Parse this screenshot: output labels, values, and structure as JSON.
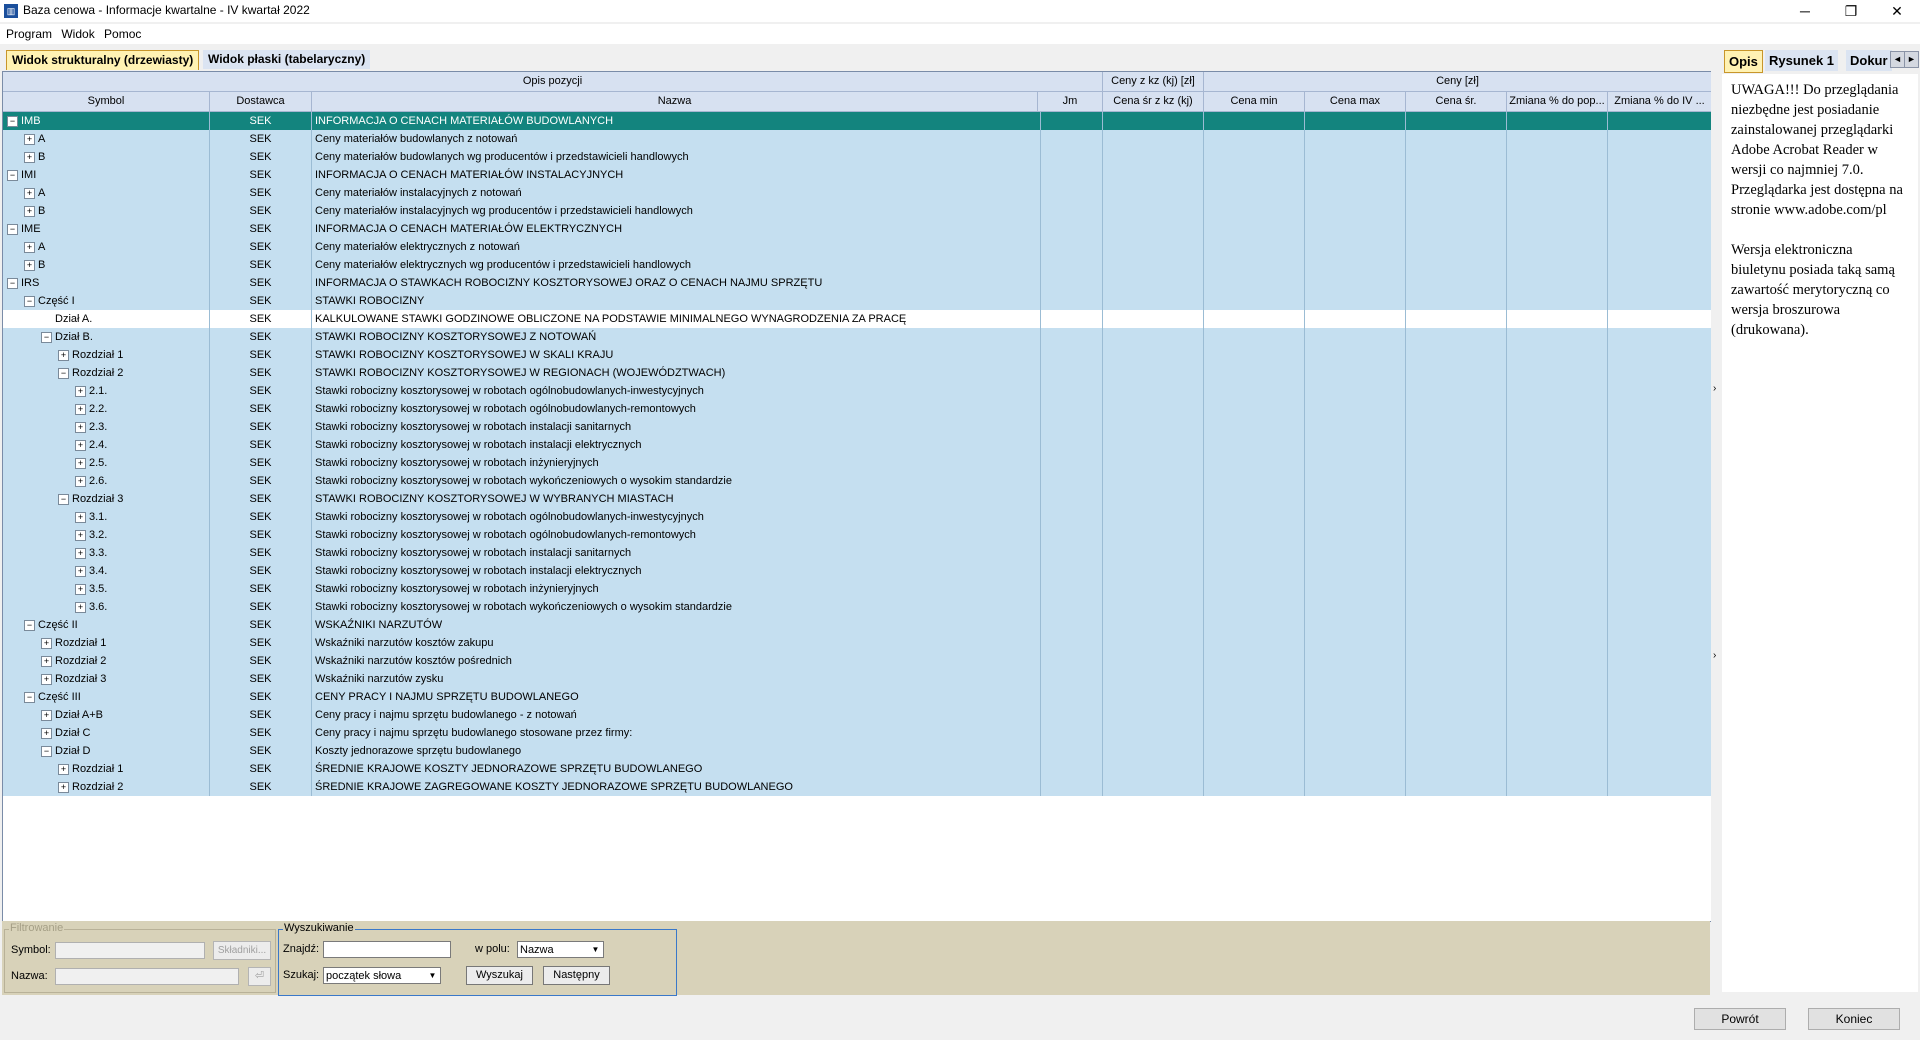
{
  "window": {
    "title": "Baza cenowa - Informacje kwartalne - IV kwartał 2022",
    "min_glyph": "─",
    "max_glyph": "❐",
    "close_glyph": "✕"
  },
  "menu": [
    "Program",
    "Widok",
    "Pomoc"
  ],
  "view_tabs": {
    "structural": "Widok strukturalny (drzewiasty)",
    "flat": "Widok płaski (tabelaryczny)"
  },
  "grid": {
    "group_headers": {
      "opis": "Opis pozycji",
      "kz": "Ceny z kz (kj) [zł]",
      "ceny": "Ceny [zł]"
    },
    "columns": {
      "symbol": "Symbol",
      "dostawca": "Dostawca",
      "nazwa": "Nazwa",
      "jm": "Jm",
      "cena_sr_kz": "Cena śr z kz (kj)",
      "cena_min": "Cena min",
      "cena_max": "Cena max",
      "cena_sr": "Cena śr.",
      "zmiana_pop": "Zmiana % do pop...",
      "zmiana_iv": "Zmiana % do IV ..."
    },
    "rows": [
      {
        "level": 0,
        "toggle": "−",
        "symbol": "IMB",
        "dostawca": "SEK",
        "nazwa": "INFORMACJA O CENACH MATERIAŁÓW BUDOWLANYCH",
        "style": "sel"
      },
      {
        "level": 1,
        "toggle": "+",
        "symbol": "A",
        "dostawca": "SEK",
        "nazwa": "Ceny materiałów budowlanych z notowań"
      },
      {
        "level": 1,
        "toggle": "+",
        "symbol": "B",
        "dostawca": "SEK",
        "nazwa": "Ceny materiałów budowlanych wg producentów i przedstawicieli handlowych"
      },
      {
        "level": 0,
        "toggle": "−",
        "symbol": "IMI",
        "dostawca": "SEK",
        "nazwa": "INFORMACJA O CENACH MATERIAŁÓW INSTALACYJNYCH"
      },
      {
        "level": 1,
        "toggle": "+",
        "symbol": "A",
        "dostawca": "SEK",
        "nazwa": "Ceny materiałów instalacyjnych z notowań"
      },
      {
        "level": 1,
        "toggle": "+",
        "symbol": "B",
        "dostawca": "SEK",
        "nazwa": "Ceny materiałów instalacyjnych wg producentów i przedstawicieli handlowych"
      },
      {
        "level": 0,
        "toggle": "−",
        "symbol": "IME",
        "dostawca": "SEK",
        "nazwa": "INFORMACJA O CENACH MATERIAŁÓW ELEKTRYCZNYCH"
      },
      {
        "level": 1,
        "toggle": "+",
        "symbol": "A",
        "dostawca": "SEK",
        "nazwa": "Ceny materiałów elektrycznych z notowań"
      },
      {
        "level": 1,
        "toggle": "+",
        "symbol": "B",
        "dostawca": "SEK",
        "nazwa": "Ceny materiałów elektrycznych wg producentów i przedstawicieli handlowych"
      },
      {
        "level": 0,
        "toggle": "−",
        "symbol": "IRS",
        "dostawca": "SEK",
        "nazwa": "INFORMACJA O STAWKACH ROBOCIZNY KOSZTORYSOWEJ ORAZ O CENACH NAJMU SPRZĘTU"
      },
      {
        "level": 1,
        "toggle": "−",
        "symbol": "Część I",
        "dostawca": "SEK",
        "nazwa": "STAWKI ROBOCIZNY"
      },
      {
        "level": 2,
        "toggle": "",
        "symbol": "Dział A.",
        "dostawca": "SEK",
        "nazwa": "KALKULOWANE STAWKI GODZINOWE OBLICZONE NA PODSTAWIE MINIMALNEGO WYNAGRODZENIA ZA PRACĘ",
        "style": "white"
      },
      {
        "level": 2,
        "toggle": "−",
        "symbol": "Dział B.",
        "dostawca": "SEK",
        "nazwa": "STAWKI ROBOCIZNY KOSZTORYSOWEJ Z NOTOWAŃ"
      },
      {
        "level": 3,
        "toggle": "+",
        "symbol": "Rozdział 1",
        "dostawca": "SEK",
        "nazwa": "STAWKI ROBOCIZNY KOSZTORYSOWEJ W SKALI KRAJU"
      },
      {
        "level": 3,
        "toggle": "−",
        "symbol": "Rozdział 2",
        "dostawca": "SEK",
        "nazwa": "STAWKI ROBOCIZNY KOSZTORYSOWEJ W REGIONACH (WOJEWÓDZTWACH)"
      },
      {
        "level": 4,
        "toggle": "+",
        "symbol": "2.1.",
        "dostawca": "SEK",
        "nazwa": "Stawki robocizny kosztorysowej w robotach ogólnobudowlanych-inwestycyjnych"
      },
      {
        "level": 4,
        "toggle": "+",
        "symbol": "2.2.",
        "dostawca": "SEK",
        "nazwa": "Stawki robocizny kosztorysowej w robotach ogólnobudowlanych-remontowych"
      },
      {
        "level": 4,
        "toggle": "+",
        "symbol": "2.3.",
        "dostawca": "SEK",
        "nazwa": "Stawki robocizny kosztorysowej w robotach instalacji sanitarnych"
      },
      {
        "level": 4,
        "toggle": "+",
        "symbol": "2.4.",
        "dostawca": "SEK",
        "nazwa": "Stawki robocizny kosztorysowej w robotach instalacji elektrycznych"
      },
      {
        "level": 4,
        "toggle": "+",
        "symbol": "2.5.",
        "dostawca": "SEK",
        "nazwa": "Stawki robocizny kosztorysowej w robotach inżynieryjnych"
      },
      {
        "level": 4,
        "toggle": "+",
        "symbol": "2.6.",
        "dostawca": "SEK",
        "nazwa": "Stawki robocizny kosztorysowej w robotach wykończeniowych o wysokim standardzie"
      },
      {
        "level": 3,
        "toggle": "−",
        "symbol": "Rozdział 3",
        "dostawca": "SEK",
        "nazwa": "STAWKI ROBOCIZNY KOSZTORYSOWEJ W WYBRANYCH MIASTACH"
      },
      {
        "level": 4,
        "toggle": "+",
        "symbol": "3.1.",
        "dostawca": "SEK",
        "nazwa": "Stawki robocizny kosztorysowej w robotach ogólnobudowlanych-inwestycyjnych"
      },
      {
        "level": 4,
        "toggle": "+",
        "symbol": "3.2.",
        "dostawca": "SEK",
        "nazwa": "Stawki robocizny kosztorysowej w robotach ogólnobudowlanych-remontowych"
      },
      {
        "level": 4,
        "toggle": "+",
        "symbol": "3.3.",
        "dostawca": "SEK",
        "nazwa": "Stawki robocizny kosztorysowej w robotach instalacji sanitarnych"
      },
      {
        "level": 4,
        "toggle": "+",
        "symbol": "3.4.",
        "dostawca": "SEK",
        "nazwa": "Stawki robocizny kosztorysowej w robotach instalacji elektrycznych"
      },
      {
        "level": 4,
        "toggle": "+",
        "symbol": "3.5.",
        "dostawca": "SEK",
        "nazwa": "Stawki robocizny kosztorysowej w robotach inżynieryjnych"
      },
      {
        "level": 4,
        "toggle": "+",
        "symbol": "3.6.",
        "dostawca": "SEK",
        "nazwa": "Stawki robocizny kosztorysowej w robotach wykończeniowych o wysokim standardzie"
      },
      {
        "level": 1,
        "toggle": "−",
        "symbol": "Część II",
        "dostawca": "SEK",
        "nazwa": "WSKAŹNIKI NARZUTÓW"
      },
      {
        "level": 2,
        "toggle": "+",
        "symbol": "Rozdział 1",
        "dostawca": "SEK",
        "nazwa": "Wskaźniki narzutów kosztów zakupu"
      },
      {
        "level": 2,
        "toggle": "+",
        "symbol": "Rozdział 2",
        "dostawca": "SEK",
        "nazwa": "Wskaźniki narzutów kosztów pośrednich"
      },
      {
        "level": 2,
        "toggle": "+",
        "symbol": "Rozdział 3",
        "dostawca": "SEK",
        "nazwa": "Wskaźniki narzutów zysku"
      },
      {
        "level": 1,
        "toggle": "−",
        "symbol": "Część III",
        "dostawca": "SEK",
        "nazwa": "CENY PRACY I NAJMU SPRZĘTU BUDOWLANEGO"
      },
      {
        "level": 2,
        "toggle": "+",
        "symbol": "Dział A+B",
        "dostawca": "SEK",
        "nazwa": "Ceny pracy i najmu sprzętu budowlanego - z notowań"
      },
      {
        "level": 2,
        "toggle": "+",
        "symbol": "Dział C",
        "dostawca": "SEK",
        "nazwa": "Ceny pracy i najmu sprzętu budowlanego stosowane przez firmy:"
      },
      {
        "level": 2,
        "toggle": "−",
        "symbol": "Dział D",
        "dostawca": "SEK",
        "nazwa": "Koszty jednorazowe sprzętu budowlanego"
      },
      {
        "level": 3,
        "toggle": "+",
        "symbol": "Rozdział 1",
        "dostawca": "SEK",
        "nazwa": "ŚREDNIE KRAJOWE KOSZTY JEDNORAZOWE SPRZĘTU BUDOWLANEGO"
      },
      {
        "level": 3,
        "toggle": "+",
        "symbol": "Rozdział 2",
        "dostawca": "SEK",
        "nazwa": "ŚREDNIE KRAJOWE ZAGREGOWANE KOSZTY JEDNORAZOWE SPRZĘTU BUDOWLANEGO"
      }
    ]
  },
  "right_panel": {
    "tabs": [
      "Opis",
      "Rysunek 1",
      "Dokur"
    ],
    "nav_prev": "◄",
    "nav_next": "►",
    "paragraph1": "UWAGA!!! Do przeglądania niezbędne jest posiadanie zainstalowanej przeglądarki Adobe Acrobat Reader w wersji co najmniej 7.0. Przeglądarka jest dostępna na stronie www.adobe.com/pl",
    "paragraph2": "Wersja elektroniczna biuletynu posiada taką samą zawartość merytoryczną co wersja broszurowa (drukowana)."
  },
  "splitter": {
    "arrow_up": "›",
    "arrow_down": "›"
  },
  "filter": {
    "legend": "Filtrowanie",
    "symbol_label": "Symbol:",
    "symbol_value": "",
    "skladniki": "Składniki...",
    "nazwa_label": "Nazwa:",
    "nazwa_value": "",
    "small_btn": "⏎"
  },
  "search": {
    "legend": "Wyszukiwanie",
    "find_label": "Znajdź:",
    "find_value": "",
    "field_label": "w polu:",
    "field_value": "Nazwa",
    "mode_label": "Szukaj:",
    "mode_value": "początek słowa",
    "search_btn": "Wyszukaj",
    "next_btn": "Następny"
  },
  "footer": {
    "back": "Powrót",
    "end": "Koniec"
  }
}
